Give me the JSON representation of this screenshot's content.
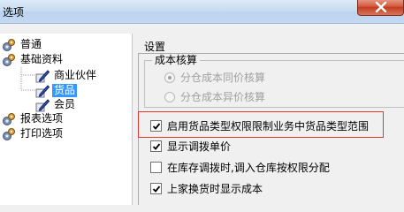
{
  "window": {
    "title": "选项"
  },
  "tree": {
    "items": [
      {
        "label": "普通"
      },
      {
        "label": "基础资料"
      },
      {
        "label": "商业伙伴"
      },
      {
        "label": "货品"
      },
      {
        "label": "会员"
      },
      {
        "label": "报表选项"
      },
      {
        "label": "打印选项"
      }
    ],
    "selected": "货品"
  },
  "settings": {
    "title": "设置",
    "cost_group": {
      "legend": "成本核算",
      "options": [
        {
          "label": "分仓成本同价核算",
          "selected": true,
          "enabled": false
        },
        {
          "label": "分仓成本异价核算",
          "selected": false,
          "enabled": false
        }
      ]
    },
    "checkboxes": [
      {
        "label": "启用货品类型权限限制业务中货品类型范围",
        "checked": true
      },
      {
        "label": "显示调拨单价",
        "checked": true
      },
      {
        "label": "在库存调拨时,调入仓库按权限分配",
        "checked": false
      },
      {
        "label": "上家换货时显示成本",
        "checked": true
      }
    ]
  },
  "colors": {
    "highlight": "#e53935",
    "selection": "#3399ff"
  }
}
